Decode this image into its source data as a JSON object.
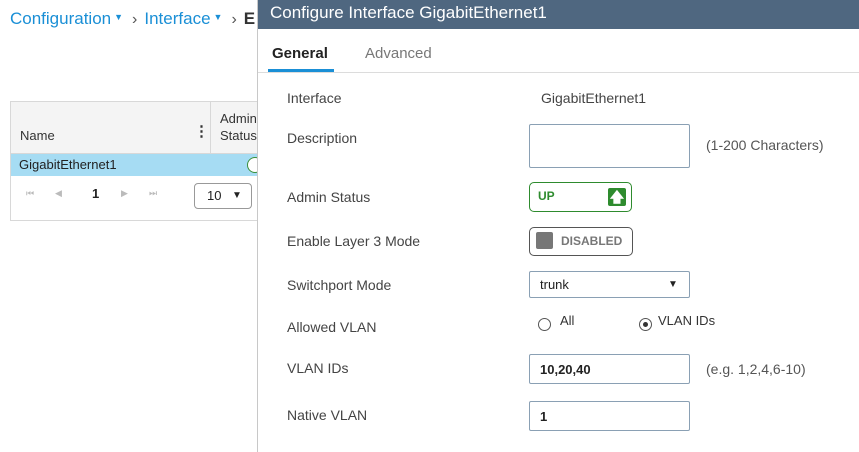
{
  "breadcrumb": {
    "items": [
      "Configuration",
      "Interface",
      "E"
    ]
  },
  "grid": {
    "columns": {
      "name": "Name",
      "admin_status_line1": "Admin",
      "admin_status_line2": "Status"
    },
    "rows": [
      {
        "name": "GigabitEthernet1"
      }
    ],
    "pager": {
      "first": "⏮",
      "prev": "◀",
      "page": "1",
      "next": "▶",
      "last": "⏭",
      "page_size": "10"
    }
  },
  "modal": {
    "title": "Configure Interface GigabitEthernet1",
    "tabs": {
      "general": "General",
      "advanced": "Advanced"
    },
    "fields": {
      "interface": {
        "label": "Interface",
        "value": "GigabitEthernet1"
      },
      "description": {
        "label": "Description",
        "value": "",
        "hint": "(1-200 Characters)"
      },
      "admin_status": {
        "label": "Admin Status",
        "value": "UP",
        "icon": "arrow-up-icon"
      },
      "layer3": {
        "label": "Enable Layer 3 Mode",
        "value": "DISABLED"
      },
      "switchport": {
        "label": "Switchport Mode",
        "value": "trunk"
      },
      "allowed_vlan": {
        "label": "Allowed VLAN",
        "options": [
          "All",
          "VLAN IDs"
        ],
        "selected": "VLAN IDs"
      },
      "vlan_ids": {
        "label": "VLAN IDs",
        "value": "10,20,40",
        "hint": "(e.g. 1,2,4,6-10)"
      },
      "native_vlan": {
        "label": "Native VLAN",
        "value": "1"
      }
    }
  },
  "colors": {
    "header_bg": "#4f6780",
    "link": "#1a8fd6",
    "up_green": "#2e8b2e",
    "selected_row": "#a6dcf3"
  }
}
